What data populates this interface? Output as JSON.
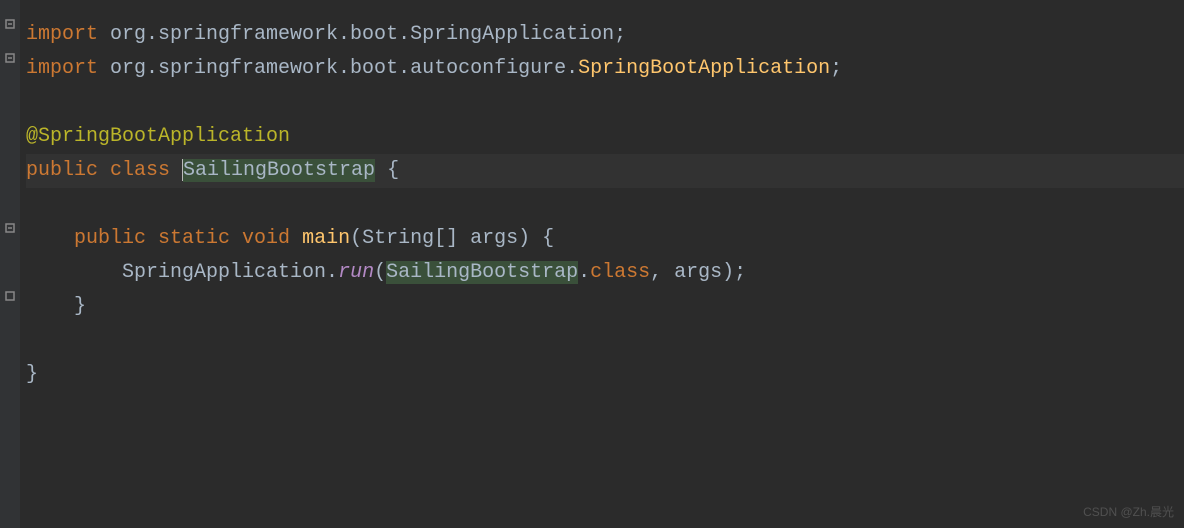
{
  "code": {
    "line1": {
      "import": "import",
      "pkg": " org.springframework.boot.SpringApplication;"
    },
    "line2": {
      "import": "import",
      "pkg": " org.springframework.boot.autoconfigure.",
      "cls": "SpringBootApplication",
      "semi": ";"
    },
    "line4": {
      "annotation": "@SpringBootApplication"
    },
    "line5": {
      "pub": "public",
      "cls": " class ",
      "name": "SailingBootstrap",
      "brace": " {"
    },
    "line7": {
      "indent": "    ",
      "pub": "public",
      "static": " static",
      "void": " void ",
      "main": "main",
      "params": "(String[] args) {"
    },
    "line8": {
      "indent": "        SpringApplication.",
      "run": "run",
      "open": "(",
      "cls": "SailingBootstrap",
      "dotclass": ".",
      "classkw": "class",
      "comma": ", ",
      "args": "args);"
    },
    "line9": {
      "indent": "    }"
    },
    "line11": {
      "brace": "}"
    }
  },
  "watermark": "CSDN @Zh.晨光"
}
